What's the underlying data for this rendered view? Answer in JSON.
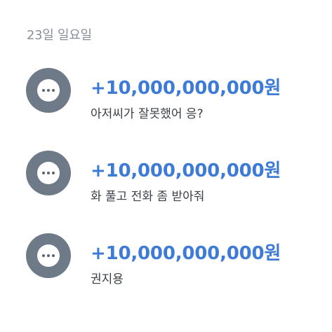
{
  "date_header": "23일 일요일",
  "icon": "more-dots-icon",
  "colors": {
    "amount": "#3e7bd6",
    "icon_circle": "#6f7a89",
    "date_text": "#8a8f99",
    "memo_text": "#3b3f46"
  },
  "transactions": [
    {
      "amount": "+10,000,000,000원",
      "memo": "아저씨가 잘못했어 응?"
    },
    {
      "amount": "+10,000,000,000원",
      "memo": "화 풀고 전화 좀 받아줘"
    },
    {
      "amount": "+10,000,000,000원",
      "memo": "권지용"
    }
  ]
}
